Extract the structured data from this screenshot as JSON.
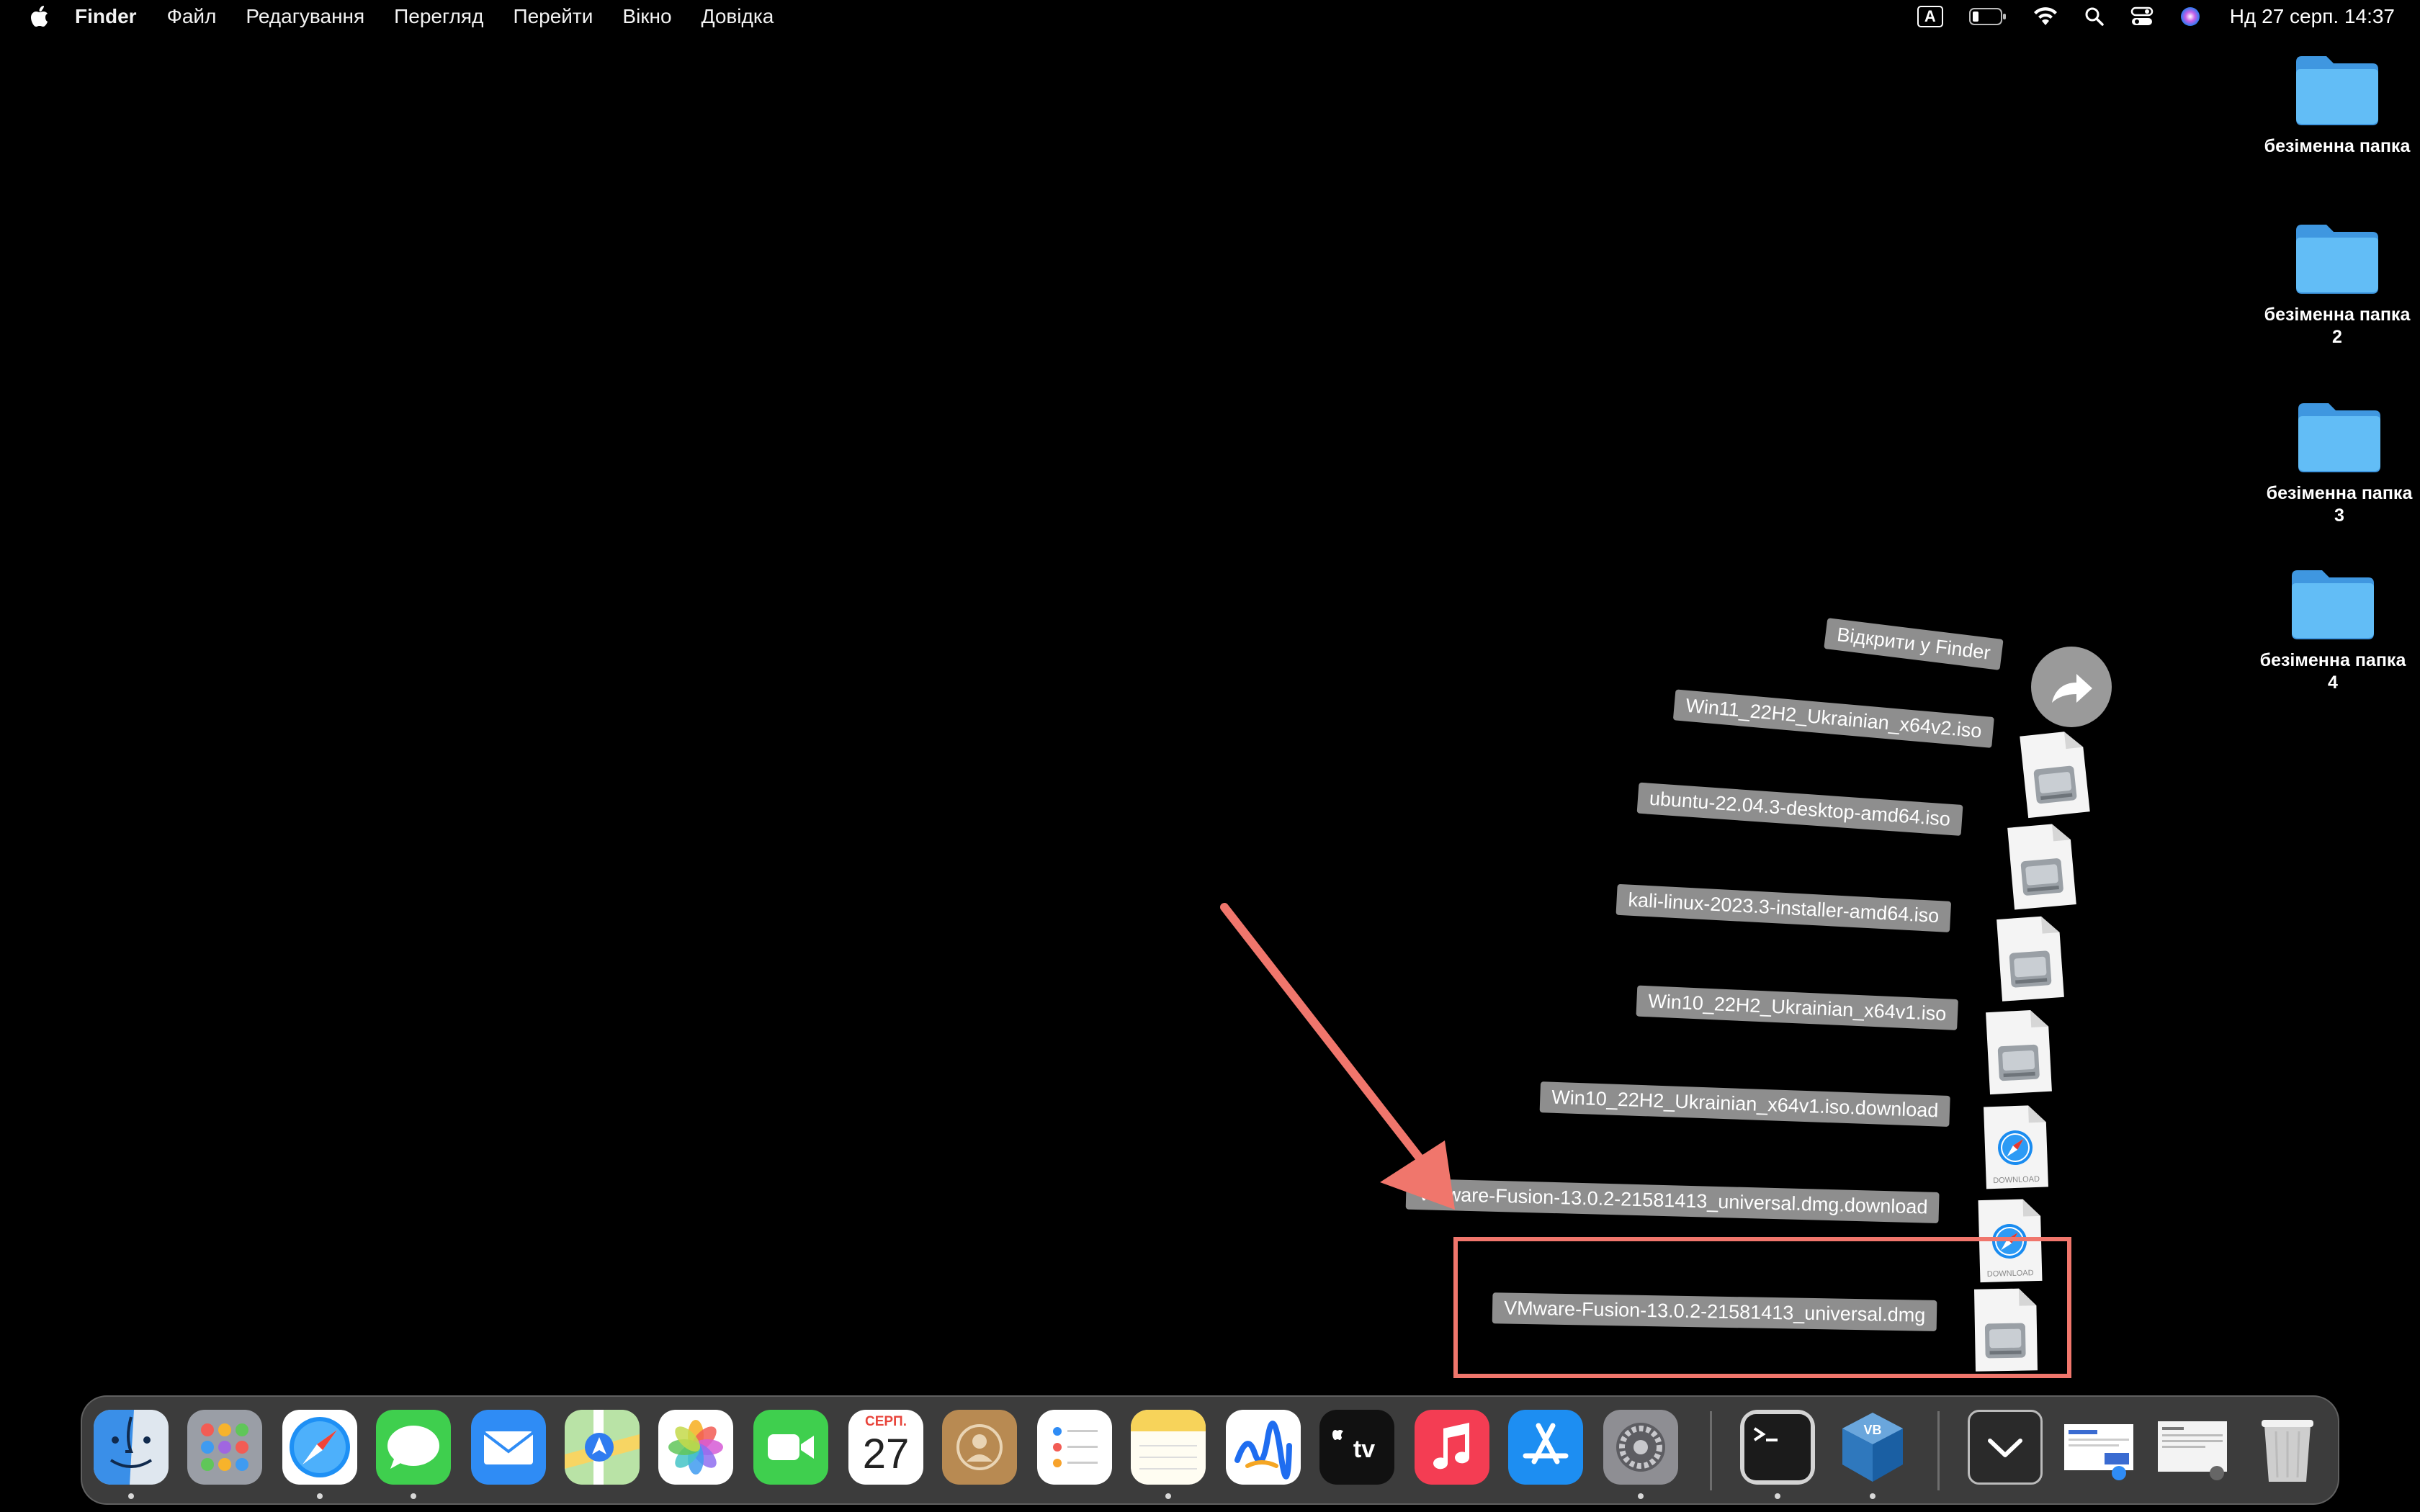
{
  "menubar": {
    "app_name": "Finder",
    "menus": [
      "Файл",
      "Редагування",
      "Перегляд",
      "Перейти",
      "Вікно",
      "Довідка"
    ],
    "input_indicator": "A",
    "clock": "Нд 27 серп.  14:37",
    "status_icons": [
      "keyboard-input-icon",
      "battery-icon",
      "wifi-icon",
      "spotlight-search-icon",
      "control-center-icon",
      "siri-icon"
    ]
  },
  "desktop": {
    "folders": [
      {
        "label": "безіменна папка"
      },
      {
        "label": "безіменна папка\n2"
      },
      {
        "label": "безіменна папка\n3"
      },
      {
        "label": "безіменна папка\n4"
      }
    ],
    "folder_color": "#5ab8f5"
  },
  "stack": {
    "open_in_finder": "Відкрити у Finder",
    "items": [
      {
        "label": "Win11_22H2_Ukrainian_x64v2.iso",
        "type": "disk-image"
      },
      {
        "label": "ubuntu-22.04.3-desktop-amd64.iso",
        "type": "disk-image"
      },
      {
        "label": "kali-linux-2023.3-installer-amd64.iso",
        "type": "disk-image"
      },
      {
        "label": "Win10_22H2_Ukrainian_x64v1.iso",
        "type": "disk-image"
      },
      {
        "label": "Win10_22H2_Ukrainian_x64v1.iso.download",
        "type": "download",
        "badge": "DOWNLOAD"
      },
      {
        "label": "VMware-Fusion-13.0.2-21581413_universal.dmg.download",
        "type": "download",
        "badge": "DOWNLOAD"
      },
      {
        "label": "VMware-Fusion-13.0.2-21581413_universal.dmg",
        "type": "disk-image"
      }
    ],
    "highlight_color": "#f0766c"
  },
  "dock": {
    "calendar": {
      "month": "СЕРП.",
      "day": "27"
    },
    "apps": [
      "Finder",
      "Launchpad",
      "Safari",
      "Messages",
      "Mail",
      "Maps",
      "Photos",
      "FaceTime",
      "Calendar",
      "Contacts",
      "Reminders",
      "Notes",
      "Freeform",
      "TV",
      "Music",
      "App Store",
      "System Settings",
      "Terminal",
      "VirtualBox",
      "Downloads stack",
      "Screenshot 1",
      "Screenshot 2",
      "Trash"
    ]
  }
}
